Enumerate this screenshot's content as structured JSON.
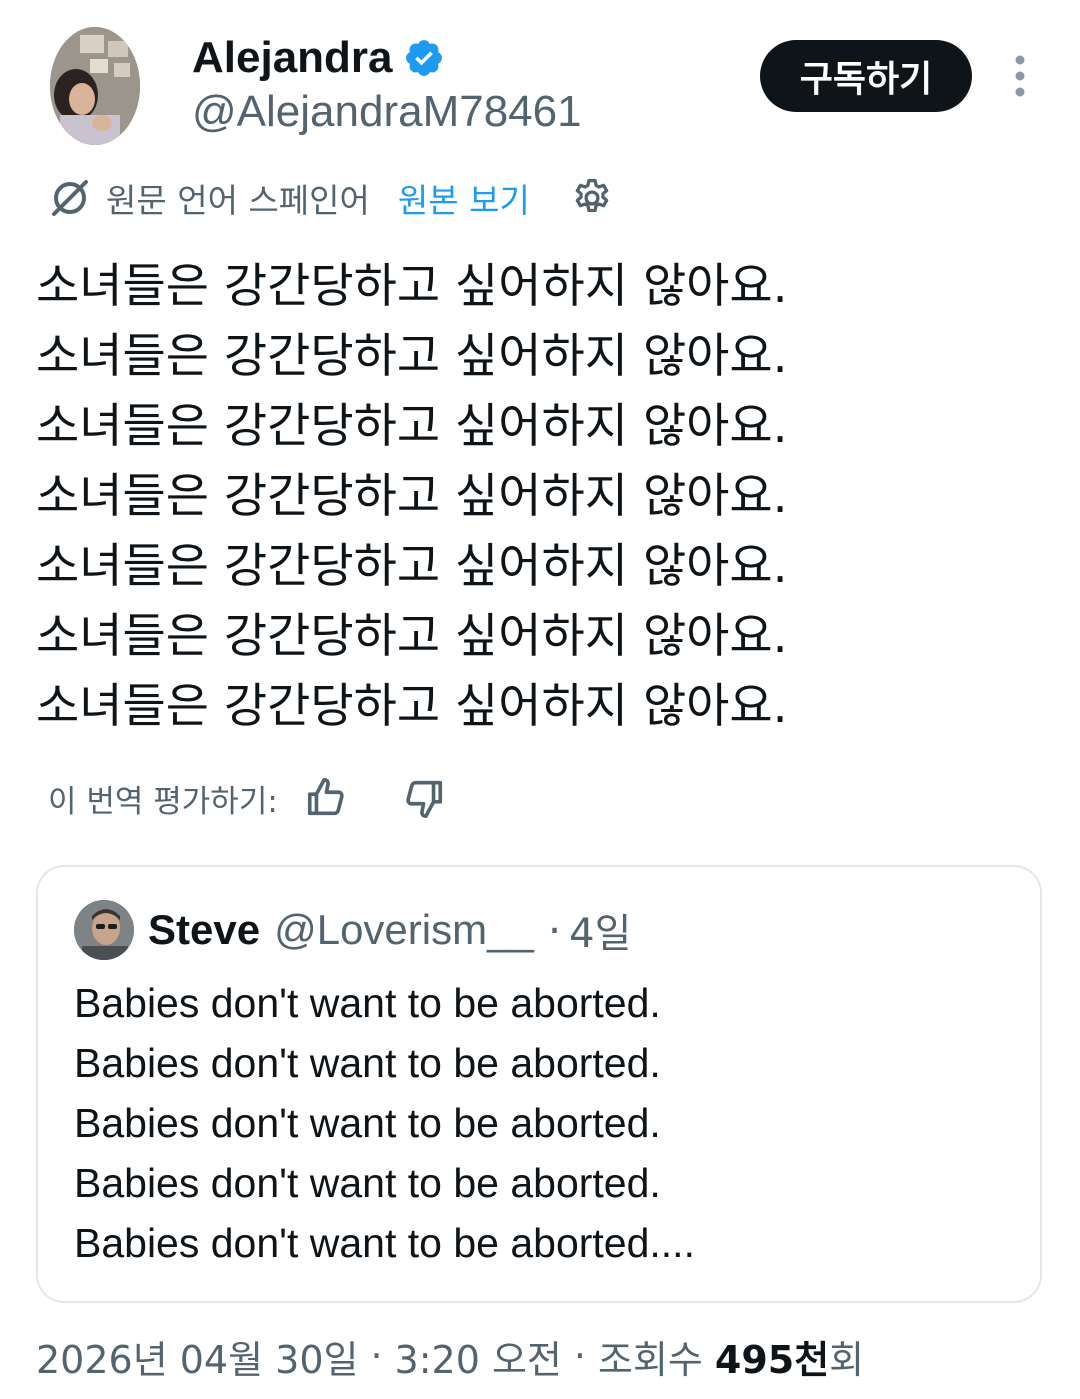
{
  "author": {
    "display_name": "Alejandra",
    "handle": "@AlejandraM78461",
    "verified": true
  },
  "actions": {
    "subscribe_label": "구독하기",
    "more_icon": "more-vertical-icon"
  },
  "translation": {
    "source_language_label": "원문 언어 스페인어",
    "show_original_label": "원본 보기",
    "icon": "translate-icon",
    "settings_icon": "gear-icon"
  },
  "tweet": {
    "lines": [
      "소녀들은 강간당하고 싶어하지 않아요.",
      "소녀들은 강간당하고 싶어하지 않아요.",
      "소녀들은 강간당하고 싶어하지 않아요.",
      "소녀들은 강간당하고 싶어하지 않아요.",
      "소녀들은 강간당하고 싶어하지 않아요.",
      "소녀들은 강간당하고 싶어하지 않아요.",
      "소녀들은 강간당하고 싶어하지 않아요."
    ]
  },
  "rating": {
    "label": "이 번역 평가하기:",
    "thumbs_up_icon": "thumbs-up-icon",
    "thumbs_down_icon": "thumbs-down-icon"
  },
  "quoted_tweet": {
    "display_name": "Steve",
    "handle": "@Loverism__",
    "separator": "·",
    "time": "4일",
    "lines": [
      "Babies don't want to be aborted.",
      "Babies don't want to be aborted.",
      "Babies don't want to be aborted.",
      "Babies don't want to be aborted.",
      "Babies don't want to be aborted...."
    ]
  },
  "meta": {
    "date": "2026년 04월 30일",
    "separator": "·",
    "time": "3:20 오전",
    "views_label": "조회수",
    "views_count": "495천",
    "views_suffix": "회"
  },
  "colors": {
    "accent": "#1d9bf0",
    "secondary_text": "#536471",
    "primary_text": "#0f1419",
    "button_bg": "#0f1419",
    "border": "#e1e8ed"
  }
}
